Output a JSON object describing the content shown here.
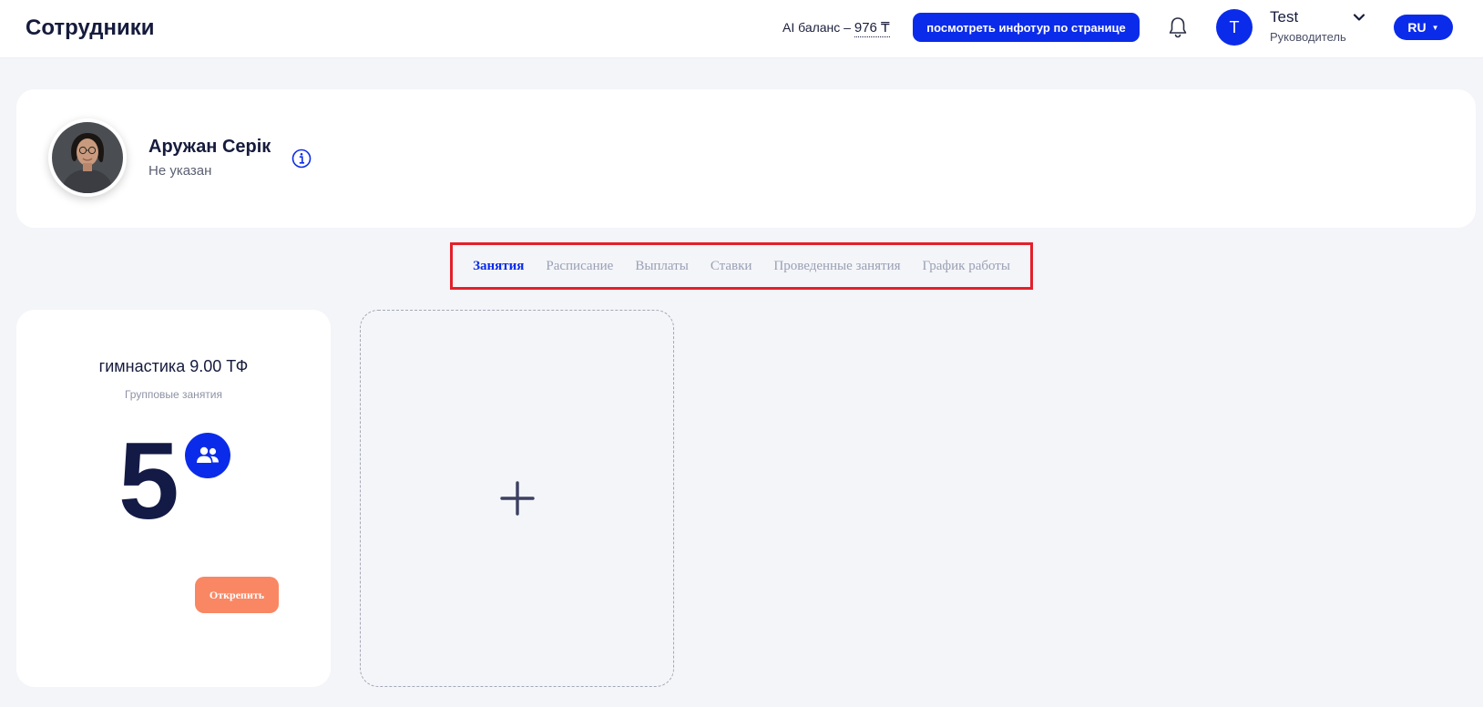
{
  "header": {
    "page_title": "Сотрудники",
    "ai_balance_label": "AI баланс –",
    "ai_balance_amount": "976 ₸",
    "infotour_button": "посмотреть инфотур по странице",
    "user": {
      "avatar_letter": "T",
      "name": "Test",
      "role": "Руководитель"
    },
    "language": "RU"
  },
  "profile": {
    "name": "Аружан Серік",
    "subtitle": "Не указан"
  },
  "tabs": [
    {
      "label": "Занятия",
      "active": true
    },
    {
      "label": "Расписание",
      "active": false
    },
    {
      "label": "Выплаты",
      "active": false
    },
    {
      "label": "Ставки",
      "active": false
    },
    {
      "label": "Проведенные занятия",
      "active": false
    },
    {
      "label": "График работы",
      "active": false
    }
  ],
  "lesson_card": {
    "title": "гимнастика 9.00 ТФ",
    "type": "Групповые занятия",
    "count": "5",
    "unpin_button": "Открепить"
  },
  "colors": {
    "primary": "#0b2bea",
    "accent_orange": "#f98764",
    "highlight_red": "#e3202a"
  },
  "icons": {
    "bell": "bell-icon",
    "info": "info-icon",
    "group": "users-icon",
    "add": "plus-icon",
    "chevron": "chevron-down-icon"
  }
}
